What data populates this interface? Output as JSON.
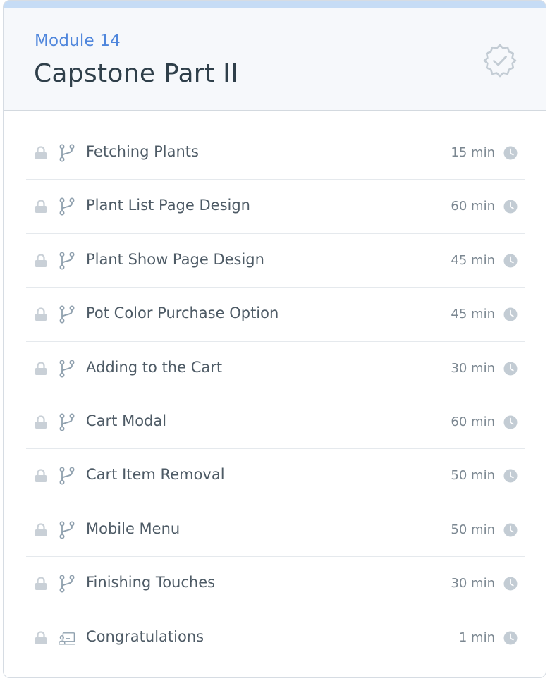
{
  "module": {
    "label": "Module 14",
    "title": "Capstone Part II",
    "status_icon": "verified-badge-icon"
  },
  "colors": {
    "accent": "#4f86dc",
    "title": "#2f3f4a",
    "muted_icon": "#b8c2cb"
  },
  "lessons": [
    {
      "title": "Fetching Plants",
      "duration": "15 min",
      "type_icon": "git-branch-icon",
      "locked": true
    },
    {
      "title": "Plant List Page Design",
      "duration": "60 min",
      "type_icon": "git-branch-icon",
      "locked": true
    },
    {
      "title": "Plant Show Page Design",
      "duration": "45 min",
      "type_icon": "git-branch-icon",
      "locked": true
    },
    {
      "title": "Pot Color Purchase Option",
      "duration": "45 min",
      "type_icon": "git-branch-icon",
      "locked": true
    },
    {
      "title": "Adding to the Cart",
      "duration": "30 min",
      "type_icon": "git-branch-icon",
      "locked": true
    },
    {
      "title": "Cart Modal",
      "duration": "60 min",
      "type_icon": "git-branch-icon",
      "locked": true
    },
    {
      "title": "Cart Item Removal",
      "duration": "50 min",
      "type_icon": "git-branch-icon",
      "locked": true
    },
    {
      "title": "Mobile Menu",
      "duration": "50 min",
      "type_icon": "git-branch-icon",
      "locked": true
    },
    {
      "title": "Finishing Touches",
      "duration": "30 min",
      "type_icon": "git-branch-icon",
      "locked": true
    },
    {
      "title": "Congratulations",
      "duration": "1 min",
      "type_icon": "presentation-icon",
      "locked": true
    }
  ]
}
